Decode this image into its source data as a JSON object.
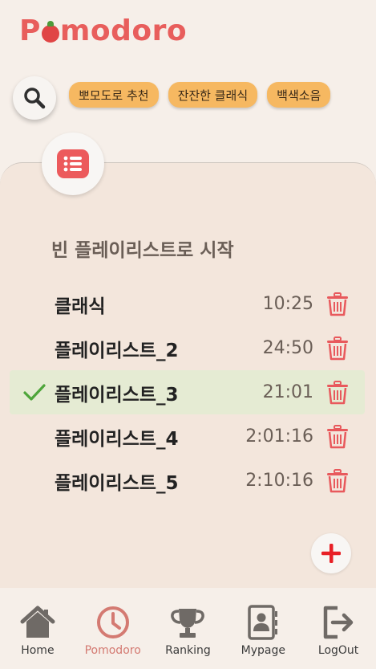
{
  "app": {
    "logo_prefix": "P",
    "logo_suffix": "modoro"
  },
  "search": {
    "icon": "search-icon"
  },
  "chips": [
    {
      "label": "뽀모도로 추천"
    },
    {
      "label": "잔잔한 클래식"
    },
    {
      "label": "백색소음"
    }
  ],
  "panel": {
    "start_empty_label": "빈 플레이리스트로 시작"
  },
  "playlists": [
    {
      "name": "클래식",
      "duration": "10:25",
      "selected": false
    },
    {
      "name": "플레이리스트_2",
      "duration": "24:50",
      "selected": false
    },
    {
      "name": "플레이리스트_3",
      "duration": "21:01",
      "selected": true
    },
    {
      "name": "플레이리스트_4",
      "duration": "2:01:16",
      "selected": false
    },
    {
      "name": "플레이리스트_5",
      "duration": "2:10:16",
      "selected": false
    }
  ],
  "nav": [
    {
      "label": "Home",
      "icon": "home-icon",
      "active": false
    },
    {
      "label": "Pomodoro",
      "icon": "clock-icon",
      "active": true
    },
    {
      "label": "Ranking",
      "icon": "trophy-icon",
      "active": false
    },
    {
      "label": "Mypage",
      "icon": "contact-book-icon",
      "active": false
    },
    {
      "label": "LogOut",
      "icon": "logout-icon",
      "active": false
    }
  ],
  "colors": {
    "accent": "#e85e5c",
    "chip": "#f6b861",
    "selected_row": "#e5ebd3",
    "check": "#4ea53a",
    "nav_active": "#d47a72"
  }
}
